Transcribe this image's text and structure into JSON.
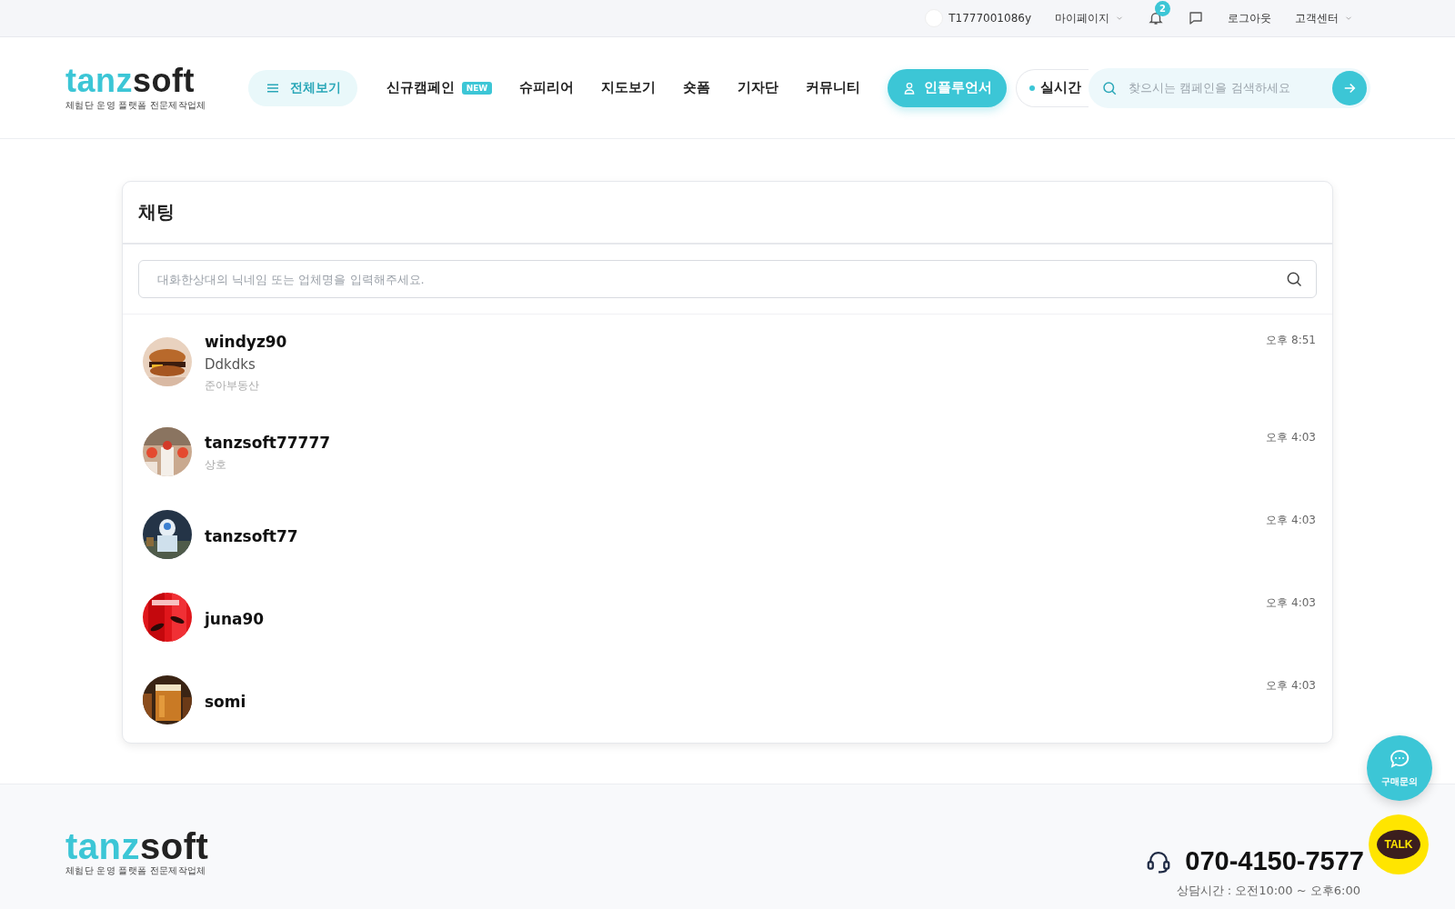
{
  "top_bar": {
    "user_id": "T1777001086y",
    "mypage": "마이페이지",
    "notifications": {
      "count": "2"
    },
    "logout": "로그아웃",
    "support": "고객센터"
  },
  "header": {
    "logo": {
      "accent": "tanz",
      "rest": "soft",
      "tagline": "체험단 운영 플랫폼 전문제작업체"
    },
    "all_menu": "전체보기",
    "nav": [
      {
        "label": "신규캠페인",
        "badge": "NEW"
      },
      {
        "label": "슈피리어"
      },
      {
        "label": "지도보기"
      },
      {
        "label": "숏폼"
      },
      {
        "label": "기자단"
      },
      {
        "label": "커뮤니티"
      }
    ],
    "influencer": "인플루언서",
    "realtime": "실시간",
    "search": {
      "placeholder": "찾으시는 캠페인을 검색하세요"
    }
  },
  "chat": {
    "title": "채팅",
    "search": {
      "placeholder": "대화한상대의 닉네임 또는 업체명을 입력해주세요."
    },
    "conversations": [
      {
        "name": "windyz90",
        "message": "Ddkdks",
        "company": "준아부동산",
        "time": "오후 8:51"
      },
      {
        "name": "tanzsoft77777",
        "company": "상호",
        "time": "오후 4:03"
      },
      {
        "name": "tanzsoft77",
        "time": "오후 4:03"
      },
      {
        "name": "juna90",
        "time": "오후 4:03"
      },
      {
        "name": "somi",
        "time": "오후 4:03"
      }
    ]
  },
  "floating": {
    "inquiry": "구매문의",
    "talk": "TALK"
  },
  "footer": {
    "logo": {
      "accent": "tanz",
      "rest": "soft",
      "tagline": "체험단 운영 플랫폼 전문제작업체"
    },
    "phone": "070-4150-7577",
    "hours": "상담시간 : 오전10:00 ~ 오후6:00"
  }
}
